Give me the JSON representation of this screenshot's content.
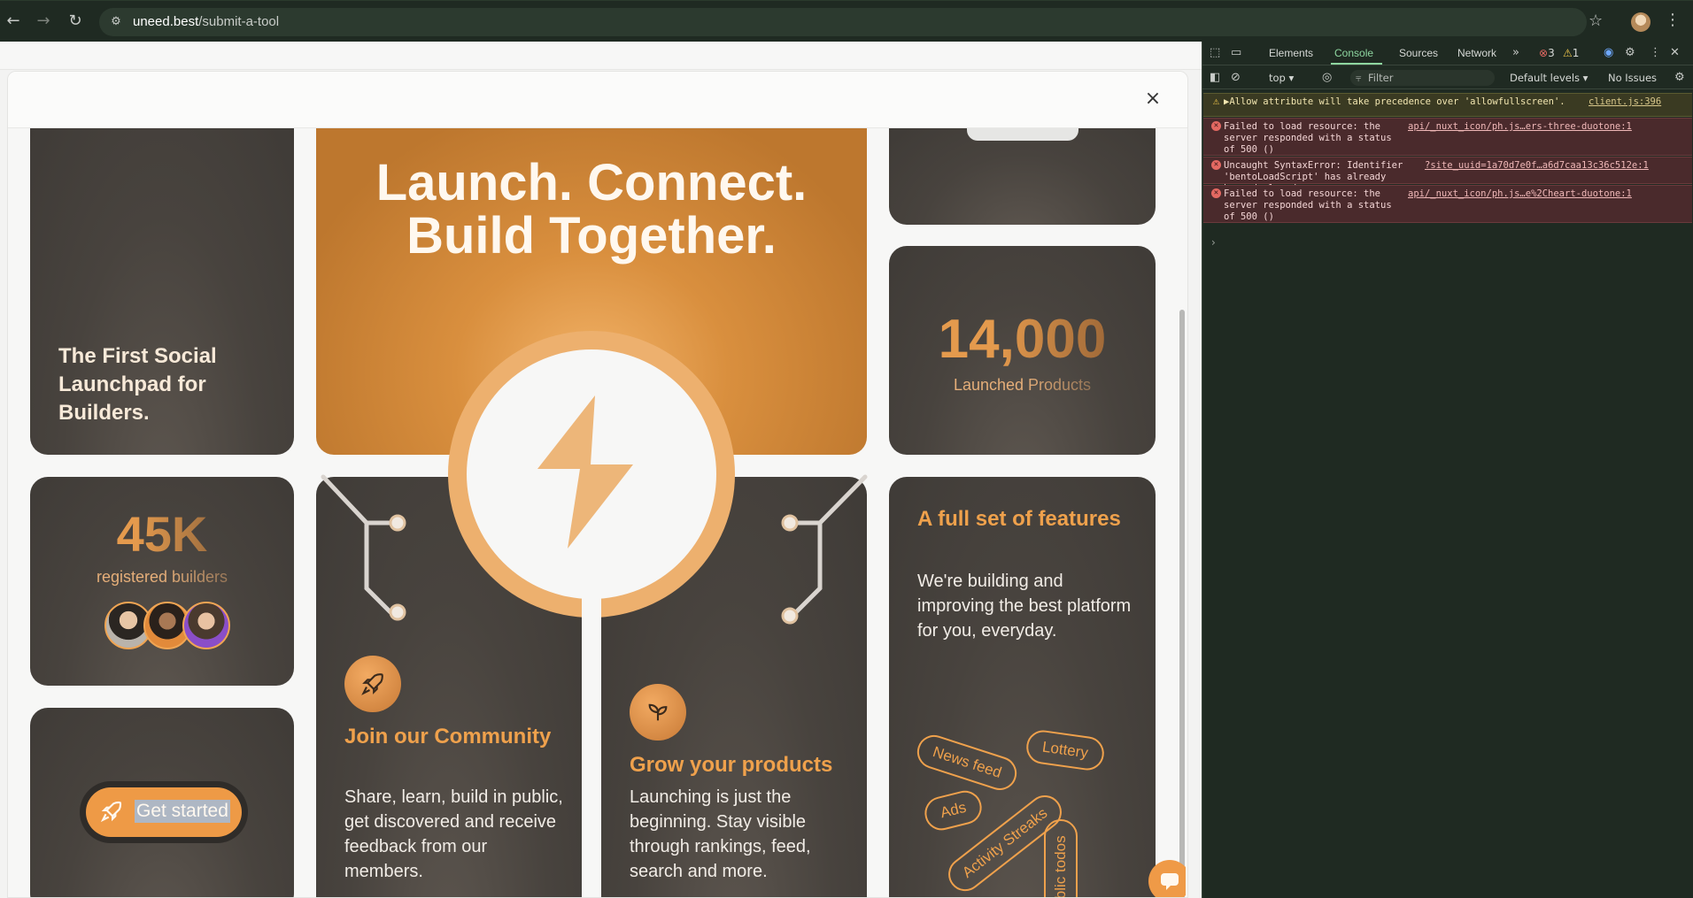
{
  "browser": {
    "url_host": "uneed.best",
    "url_path": "/submit-a-tool"
  },
  "modal": {
    "close_label": "×"
  },
  "cards": {
    "intro_title": "The First Social Launchpad for Builders.",
    "hero_title_line1": "Launch. Connect.",
    "hero_title_line2": "Build Together.",
    "launched_number": "14,000",
    "launched_label": "Launched Products",
    "builders_number": "45K",
    "builders_label": "registered builders",
    "get_started_label": "Get started",
    "community_title": "Join our Community",
    "community_desc": "Share, learn, build in public, get discovered and receive feedback from our members.",
    "grow_title": "Grow your products",
    "grow_desc": "Launching is just the beginning. Stay visible through rankings, feed, search and more.",
    "features_title": "A full set of features",
    "features_desc": "We're building and improving the best platform for you, everyday.",
    "feature_tags": [
      "News feed",
      "Lottery",
      "Ads",
      "Activity Streaks",
      "Public todos"
    ]
  },
  "devtools": {
    "tabs": [
      "Elements",
      "Console",
      "Sources",
      "Network"
    ],
    "active_tab": "Console",
    "error_count": "3",
    "warning_count": "1",
    "context": "top",
    "filter_placeholder": "Filter",
    "levels": "Default levels",
    "issues": "No Issues",
    "messages": [
      {
        "level": "warning",
        "text": "▶Allow attribute will take precedence over 'allowfullscreen'.",
        "source": "client.js:396"
      },
      {
        "level": "error",
        "text": "Failed to load resource: the server responded with a status of 500 ()",
        "source": "api/_nuxt_icon/ph.js…ers-three-duotone:1"
      },
      {
        "level": "error",
        "text": "Uncaught SyntaxError: Identifier 'bentoLoadScript' has already been declared",
        "source": "?site_uuid=1a70d7e0f…a6d7caa13c36c512e:1"
      },
      {
        "level": "error",
        "text": "Failed to load resource: the server responded with a status of 500 ()",
        "source": "api/_nuxt_icon/ph.js…e%2Cheart-duotone:1"
      }
    ],
    "prompt": "›"
  },
  "colors": {
    "accent": "#efa14c",
    "card_bg": "#48433e",
    "hero_bg": "#d98f3e",
    "devtools_bg": "#1f2a22"
  }
}
